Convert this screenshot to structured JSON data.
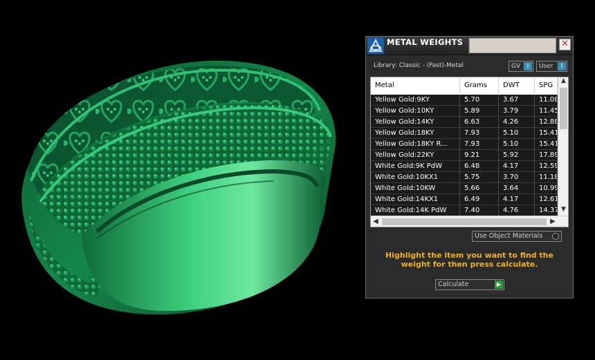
{
  "panel": {
    "title": "METAL WEIGHTS",
    "close_label": "✕",
    "library_label": "Library: Classic - (Fast)-Metal",
    "gv_toggle": {
      "label": "GV",
      "knob": "I"
    },
    "user_toggle": {
      "label": "User",
      "knob": "I"
    }
  },
  "table": {
    "columns": [
      "Metal",
      "Grams",
      "DWT",
      "SPG"
    ],
    "rows": [
      {
        "metal": "Yellow Gold:9KY",
        "grams": "5.70",
        "dwt": "3.67",
        "spg": "11.08"
      },
      {
        "metal": "Yellow Gold:10KY",
        "grams": "5.89",
        "dwt": "3.79",
        "spg": "11.45"
      },
      {
        "metal": "Yellow Gold:14KY",
        "grams": "6.63",
        "dwt": "4.26",
        "spg": "12.88"
      },
      {
        "metal": "Yellow Gold:18KY",
        "grams": "7.93",
        "dwt": "5.10",
        "spg": "15.41"
      },
      {
        "metal": "Yellow Gold:18KY R...",
        "grams": "7.93",
        "dwt": "5.10",
        "spg": "15.41"
      },
      {
        "metal": "Yellow Gold:22KY",
        "grams": "9.21",
        "dwt": "5.92",
        "spg": "17.89"
      },
      {
        "metal": "White Gold:9K PdW",
        "grams": "6.48",
        "dwt": "4.17",
        "spg": "12.59"
      },
      {
        "metal": "White Gold:10KX1",
        "grams": "5.75",
        "dwt": "3.70",
        "spg": "11.18"
      },
      {
        "metal": "White Gold:10KW",
        "grams": "5.66",
        "dwt": "3.64",
        "spg": "10.99"
      },
      {
        "metal": "White Gold:14KX1",
        "grams": "6.49",
        "dwt": "4.17",
        "spg": "12.61"
      },
      {
        "metal": "White Gold:14K PdW",
        "grams": "7.40",
        "dwt": "4.76",
        "spg": "14.37"
      }
    ],
    "scroll_up": "▲",
    "scroll_down": "▼",
    "scroll_left": "◀",
    "scroll_right": "▶"
  },
  "controls": {
    "use_materials_label": "Use Object Materials",
    "hint": "Highlight the item you want to find the weight for then press calculate.",
    "calculate_label": "Calculate",
    "calculate_go": "▶"
  },
  "colors": {
    "ring_green": "#1fa05a",
    "hint_text": "#f0b020",
    "toggle_knob": "#3a8fb0"
  }
}
